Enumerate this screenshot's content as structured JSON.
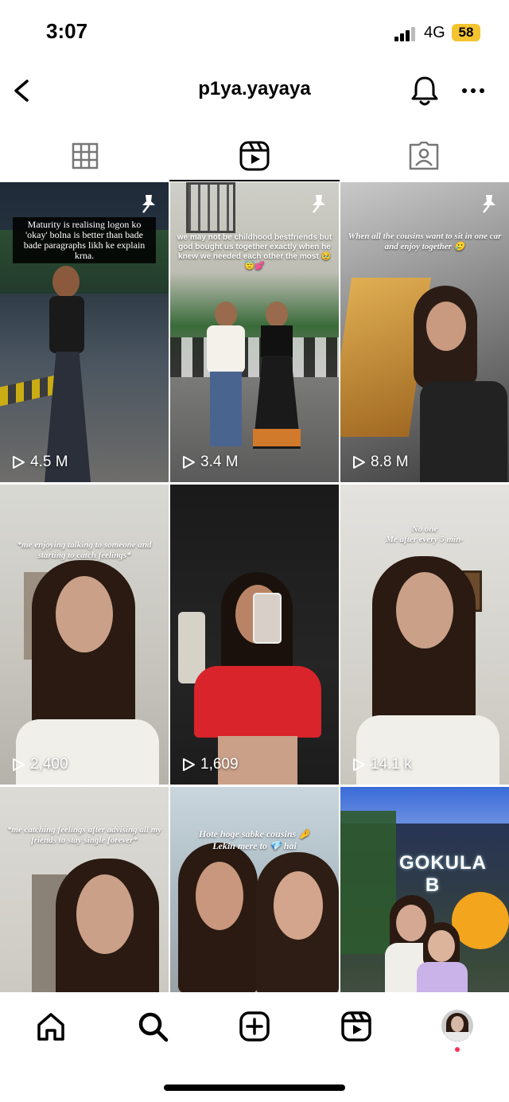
{
  "status": {
    "time": "3:07",
    "network": "4G",
    "battery": "58"
  },
  "header": {
    "username": "p1ya.yayaya"
  },
  "tabs": [
    {
      "name": "posts",
      "icon": "grid-icon"
    },
    {
      "name": "reels",
      "icon": "reels-icon",
      "active": true
    },
    {
      "name": "tagged",
      "icon": "tagged-icon"
    }
  ],
  "reels": [
    {
      "caption": "Maturity is realising logon ko 'okay' bolna is better than bade bade paragraphs likh ke explain krna.",
      "views": "4.5 M",
      "pinned": true
    },
    {
      "caption": "we may not be childhood bestfriends but god bought us together exactly when he knew we needed each other the most 🥹😇💕",
      "views": "3.4 M",
      "pinned": true
    },
    {
      "caption": "When all the cousins want to sit in one car and enjoy together 🥲",
      "views": "8.8 M",
      "pinned": true
    },
    {
      "caption": "*me enjoying talking to someone and starting to catch feelings*",
      "views": "2,400",
      "pinned": false
    },
    {
      "caption": "",
      "views": "1,609",
      "pinned": false
    },
    {
      "caption": "No one\nMe after every 5 min-",
      "views": "14.1 k",
      "pinned": false
    },
    {
      "caption": "*me catching feelings after advising all my friends to stay single forever*",
      "views": "",
      "pinned": false
    },
    {
      "caption": "Hote hoge sabke cousins 🤌\nLekin mere to 💎 hai",
      "views": "",
      "pinned": false
    },
    {
      "caption": "",
      "views": "",
      "pinned": false,
      "sign_text": "GOKULA B"
    }
  ],
  "nav": [
    {
      "name": "home",
      "icon": "home-icon"
    },
    {
      "name": "search",
      "icon": "search-icon"
    },
    {
      "name": "create",
      "icon": "create-icon"
    },
    {
      "name": "reels",
      "icon": "reels-icon"
    },
    {
      "name": "profile",
      "icon": "profile-avatar"
    }
  ],
  "colors": {
    "battery": "#f4c430",
    "notification": "#ff2d55"
  }
}
